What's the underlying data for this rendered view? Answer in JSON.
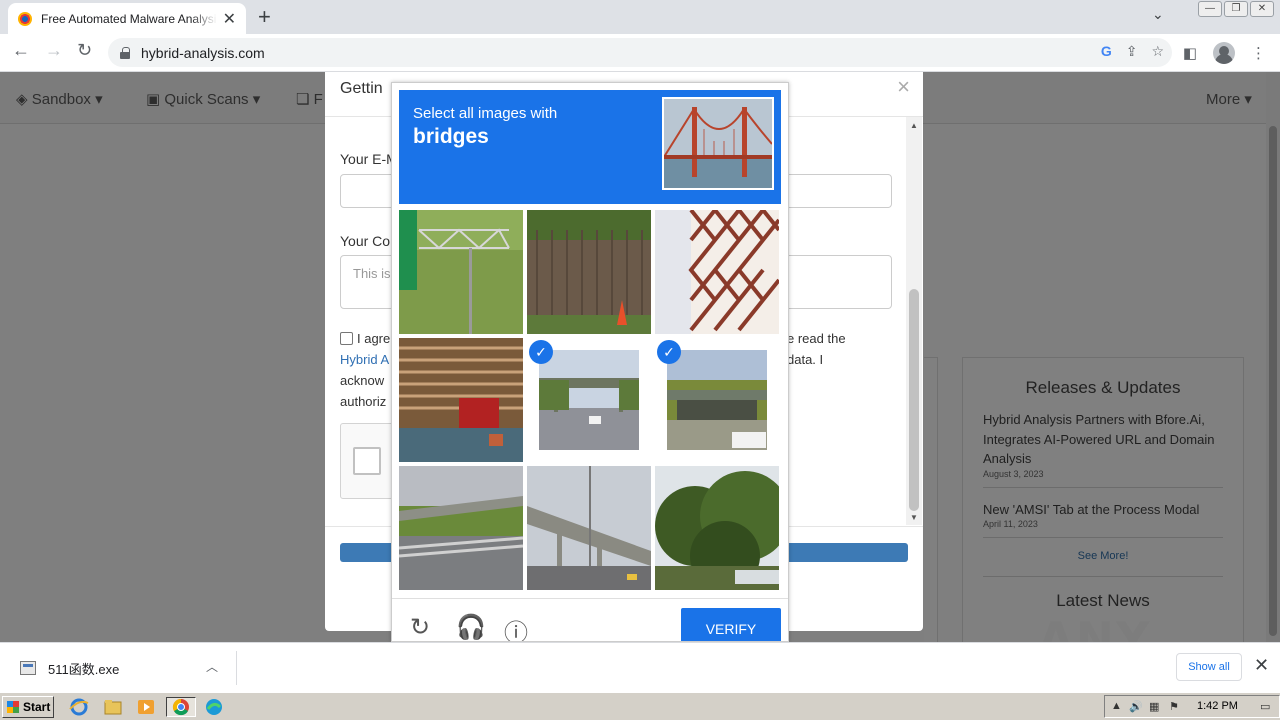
{
  "browser": {
    "tab_title": "Free Automated Malware Analysis Service - powered by Falcon Sandbox",
    "url": "hybrid-analysis.com"
  },
  "site_nav": {
    "items": [
      "Sandbox",
      "Quick Scans",
      "F"
    ],
    "more": "More"
  },
  "modal": {
    "title": "Gettin",
    "email_label": "Your E-M",
    "comment_label": "Your Co",
    "comment_placeholder": "This is",
    "agree_line1": "I agre",
    "agree_link": "Hybrid A",
    "agree_line3": "acknow",
    "agree_line4": "authoriz",
    "right_line1": "e read the",
    "right_line2": "data. I"
  },
  "captcha": {
    "instruction": "Select all images with",
    "target": "bridges",
    "verify_label": "VERIFY",
    "tiles": [
      {
        "scene": "sign-gantry-grass",
        "selected": false
      },
      {
        "scene": "fence-palm-cone",
        "selected": false
      },
      {
        "scene": "lattice-wall",
        "selected": false
      },
      {
        "scene": "house-steps",
        "selected": false
      },
      {
        "scene": "road-overpass",
        "selected": true
      },
      {
        "scene": "overpass-trees",
        "selected": true
      },
      {
        "scene": "highway-overpass-guardrail",
        "selected": false
      },
      {
        "scene": "elevated-highway",
        "selected": false
      },
      {
        "scene": "trees",
        "selected": false
      }
    ]
  },
  "sidebar": {
    "releases_title": "Releases & Updates",
    "news": [
      {
        "title": "Hybrid Analysis Partners with Bfore.Ai, Integrates AI-Powered URL and Domain Analysis",
        "date": "August 3, 2023"
      },
      {
        "title": "New 'AMSI' Tab at the Process Modal",
        "date": "April 11, 2023"
      }
    ],
    "see_more": "See More!",
    "latest_news": "Latest News"
  },
  "downloads": {
    "file_name": "511函数.exe",
    "show_all": "Show all"
  },
  "watermark": "ANY RUN",
  "taskbar": {
    "start_label": "Start",
    "clock": "1:42 PM"
  },
  "colors": {
    "captcha_blue": "#1a73e8",
    "link_blue": "#2f6fb3",
    "submit_blue": "#3d7ab5"
  }
}
